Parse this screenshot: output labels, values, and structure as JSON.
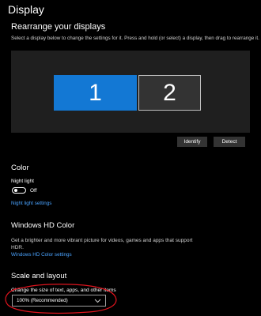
{
  "header": {
    "title": "Display"
  },
  "rearrange": {
    "heading": "Rearrange your displays",
    "hint": "Select a display below to change the settings for it. Press and hold (or select) a display, then drag to rearrange it.",
    "monitors": [
      "1",
      "2"
    ],
    "identify_label": "Identify",
    "detect_label": "Detect"
  },
  "color": {
    "heading": "Color",
    "night_light_label": "Night light",
    "toggle_state": "Off",
    "night_light_settings_link": "Night light settings"
  },
  "hd_color": {
    "heading": "Windows HD Color",
    "description": "Get a brighter and more vibrant picture for videos, games and apps that support HDR.",
    "settings_link": "Windows HD Color settings"
  },
  "scale": {
    "heading": "Scale and layout",
    "change_size_label": "Change the size of text, apps, and other items",
    "selected_value": "100% (Recommended)"
  },
  "colors": {
    "accent": "#1378d4",
    "link": "#4aa3ff",
    "annotation": "#e0141e"
  }
}
